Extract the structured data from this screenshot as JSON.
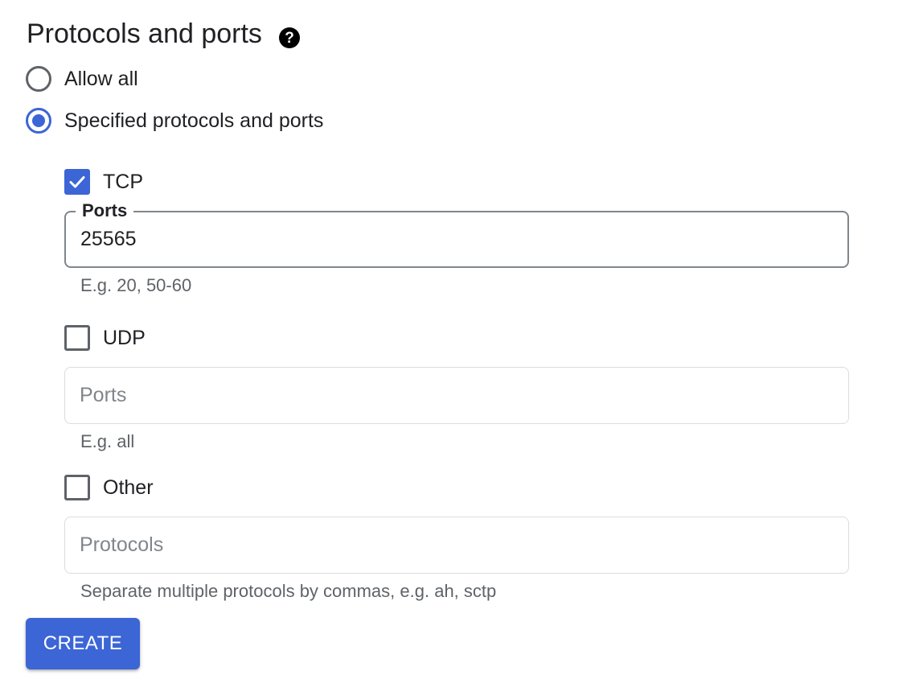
{
  "section": {
    "title": "Protocols and ports",
    "help_icon": "help-circle-icon"
  },
  "radios": {
    "allow_all": {
      "label": "Allow all",
      "checked": false
    },
    "specified": {
      "label": "Specified protocols and ports",
      "checked": true
    }
  },
  "tcp": {
    "label": "TCP",
    "checked": true,
    "field_label": "Ports",
    "value": "25565",
    "hint": "E.g. 20, 50-60"
  },
  "udp": {
    "label": "UDP",
    "checked": false,
    "placeholder": "Ports",
    "value": "",
    "hint": "E.g. all"
  },
  "other": {
    "label": "Other",
    "checked": false,
    "placeholder": "Protocols",
    "value": "",
    "hint": "Separate multiple protocols by commas, e.g. ah, sctp"
  },
  "actions": {
    "create_label": "CREATE"
  },
  "colors": {
    "accent": "#3c65d6",
    "text": "#202124",
    "hint": "#5f6368",
    "border": "#dadce0"
  }
}
